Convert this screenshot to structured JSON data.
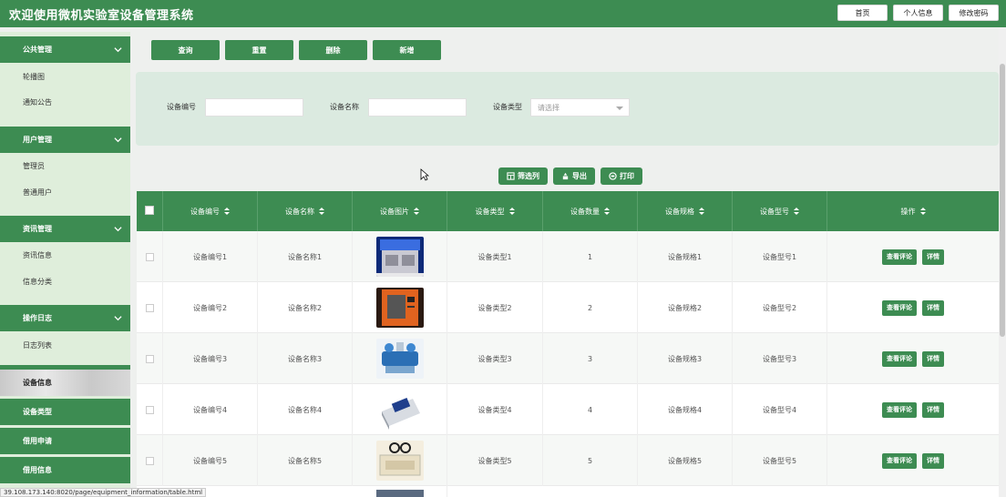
{
  "header": {
    "title": "欢迎使用微机实验室设备管理系统",
    "buttons": [
      "首页",
      "个人信息",
      "修改密码"
    ]
  },
  "sidebar": {
    "sections": [
      {
        "title": "公共管理",
        "items": [
          "轮播图",
          "通知公告"
        ]
      },
      {
        "title": "用户管理",
        "items": [
          "管理员",
          "普通用户"
        ]
      },
      {
        "title": "资讯管理",
        "items": [
          "资讯信息",
          "信息分类"
        ]
      },
      {
        "title": "操作日志",
        "items": [
          "日志列表"
        ]
      }
    ],
    "solid_items": [
      "设备信息",
      "设备类型",
      "借用申请",
      "借用信息"
    ],
    "active_item": "设备信息"
  },
  "actions": [
    "查询",
    "重置",
    "删除",
    "新增"
  ],
  "search": {
    "fields": [
      {
        "label": "设备编号",
        "value": ""
      },
      {
        "label": "设备名称",
        "value": ""
      }
    ],
    "type_label": "设备类型",
    "type_placeholder": "请选择"
  },
  "toolbar": [
    "筛选列",
    "导出",
    "打印"
  ],
  "table": {
    "columns": [
      "设备编号",
      "设备名称",
      "设备图片",
      "设备类型",
      "设备数量",
      "设备规格",
      "设备型号",
      "操作"
    ],
    "rows": [
      {
        "code": "设备编号1",
        "name": "设备名称1",
        "image": "lab-equipment-1",
        "type": "设备类型1",
        "qty": "1",
        "spec": "设备规格1",
        "model": "设备型号1"
      },
      {
        "code": "设备编号2",
        "name": "设备名称2",
        "image": "lab-equipment-2",
        "type": "设备类型2",
        "qty": "2",
        "spec": "设备规格2",
        "model": "设备型号2"
      },
      {
        "code": "设备编号3",
        "name": "设备名称3",
        "image": "lab-equipment-3",
        "type": "设备类型3",
        "qty": "3",
        "spec": "设备规格3",
        "model": "设备型号3"
      },
      {
        "code": "设备编号4",
        "name": "设备名称4",
        "image": "lab-equipment-4",
        "type": "设备类型4",
        "qty": "4",
        "spec": "设备规格4",
        "model": "设备型号4"
      },
      {
        "code": "设备编号5",
        "name": "设备名称5",
        "image": "lab-equipment-5",
        "type": "设备类型5",
        "qty": "5",
        "spec": "设备规格5",
        "model": "设备型号5"
      }
    ],
    "row_actions": [
      "查看评论",
      "详情"
    ]
  },
  "status_url": "39.108.173.140:8020/page/equipment_information/table.html",
  "colors": {
    "brand": "#3d8c52",
    "sidebar_bg": "#dfeedb",
    "panel_bg": "#dbeae0"
  }
}
